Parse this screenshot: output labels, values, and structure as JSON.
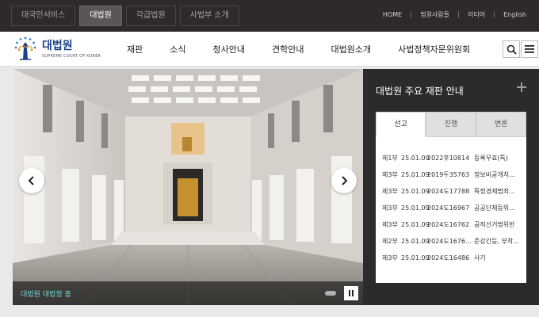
{
  "topbar": {
    "sites": [
      {
        "label": "대국민서비스",
        "active": false
      },
      {
        "label": "대법원",
        "active": true
      },
      {
        "label": "각급법원",
        "active": false
      },
      {
        "label": "사법부 소개",
        "active": false
      }
    ],
    "util": [
      "HOME",
      "법원사람들",
      "이티어",
      "English"
    ]
  },
  "logo": {
    "kr": "대법원",
    "en": "SUPREME COURT OF KOREA"
  },
  "nav": {
    "items": [
      "재판",
      "소식",
      "청사안내",
      "견학안내",
      "대법원소개",
      "사법정책자문위원회"
    ]
  },
  "hero": {
    "caption": "대법원 대법정 홀",
    "accent": "#6fd4d6"
  },
  "panel": {
    "title": "대법원 주요 재판 안내",
    "tabs": [
      {
        "label": "선고",
        "active": true
      },
      {
        "label": "진행",
        "active": false
      },
      {
        "label": "변론",
        "active": false
      }
    ],
    "cases": [
      {
        "division": "제1부",
        "date": "25.01.09",
        "number": "2022후10814",
        "title": "등록무효(특)"
      },
      {
        "division": "제3부",
        "date": "25.01.09",
        "number": "2019두35763",
        "title": "정보비공개처…"
      },
      {
        "division": "제3부",
        "date": "25.01.09",
        "number": "2024도17788",
        "title": "특정경제범죄…"
      },
      {
        "division": "제3부",
        "date": "25.01.09",
        "number": "2024도16967",
        "title": "공공단체등위…"
      },
      {
        "division": "제3부",
        "date": "25.01.09",
        "number": "2024도16762",
        "title": "공직선거법위반"
      },
      {
        "division": "제2부",
        "date": "25.01.09",
        "number": "2024도1676…",
        "title": "준강간등, 부착…"
      },
      {
        "division": "제3부",
        "date": "25.01.09",
        "number": "2024도16486",
        "title": "사기"
      }
    ]
  },
  "colors": {
    "topbar": "#2e2a2c",
    "brand": "#1d3f8c",
    "panel": "#2b2a2c"
  }
}
